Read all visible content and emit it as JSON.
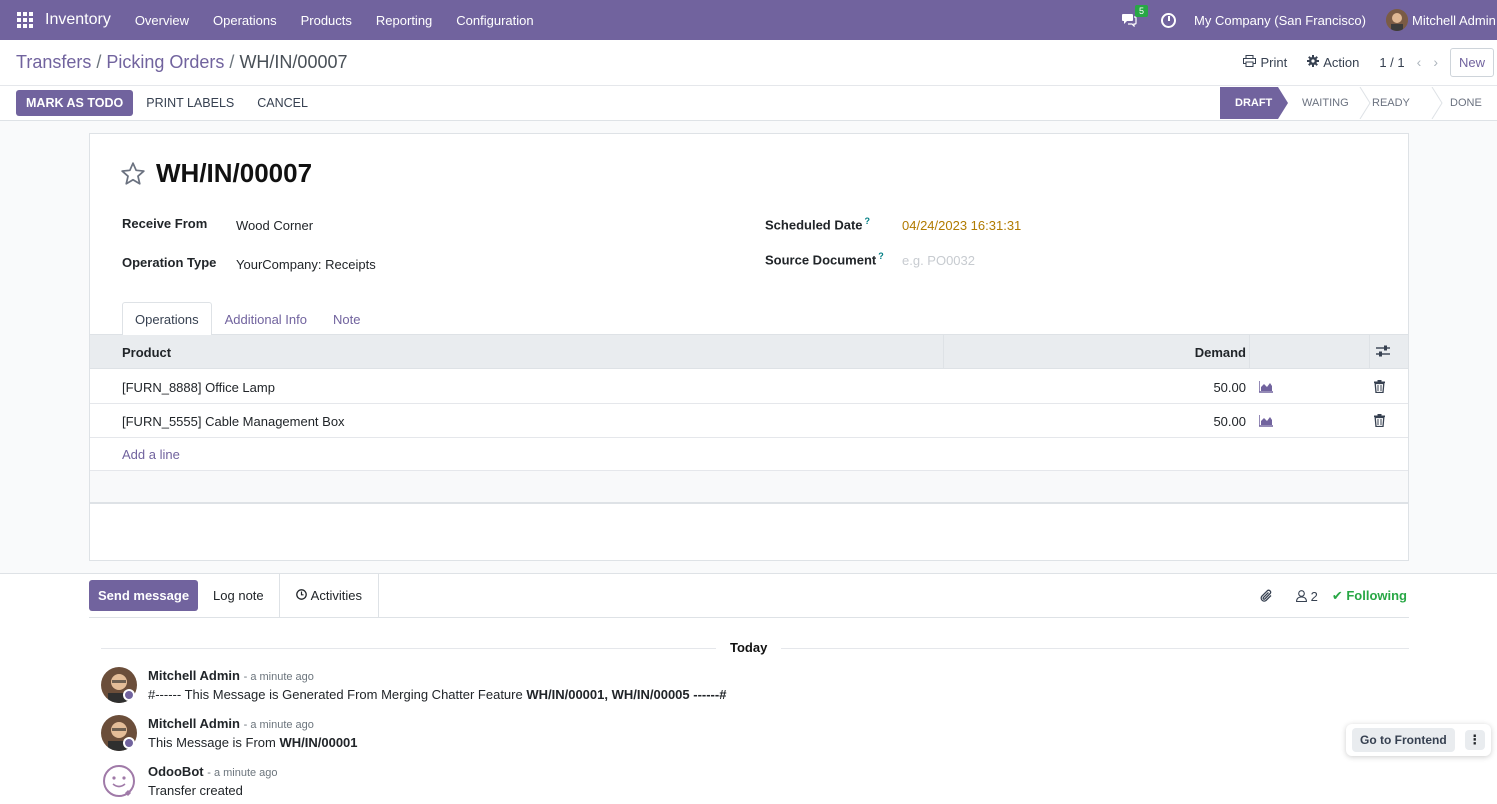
{
  "navbar": {
    "app_name": "Inventory",
    "menu": [
      "Overview",
      "Operations",
      "Products",
      "Reporting",
      "Configuration"
    ],
    "chat_count": "5",
    "company": "My Company (San Francisco)",
    "user": "Mitchell Admin"
  },
  "control_panel": {
    "breadcrumb": [
      "Transfers",
      "Picking Orders",
      "WH/IN/00007"
    ],
    "print_label": "Print",
    "action_label": "Action",
    "pager": "1 / 1",
    "new_label": "New",
    "buttons": [
      "MARK AS TODO",
      "PRINT LABELS",
      "CANCEL"
    ],
    "steps": [
      "DRAFT",
      "WAITING",
      "READY",
      "DONE"
    ],
    "active_step": "DRAFT"
  },
  "form": {
    "title": "WH/IN/00007",
    "receive_from_label": "Receive From",
    "receive_from": "Wood Corner",
    "operation_type_label": "Operation Type",
    "operation_type": "YourCompany: Receipts",
    "scheduled_date_label": "Scheduled Date",
    "scheduled_date": "04/24/2023 16:31:31",
    "source_document_label": "Source Document",
    "source_document_placeholder": "e.g. PO0032",
    "help_mark": "?",
    "tabs": [
      "Operations",
      "Additional Info",
      "Note"
    ],
    "columns": {
      "product": "Product",
      "demand": "Demand"
    },
    "rows": [
      {
        "product": "[FURN_8888] Office Lamp",
        "demand": "50.00"
      },
      {
        "product": "[FURN_5555] Cable Management Box",
        "demand": "50.00"
      }
    ],
    "add_line": "Add a line"
  },
  "chatter": {
    "send_message": "Send message",
    "log_note": "Log note",
    "activities": "Activities",
    "followers_count": "2",
    "following": "Following",
    "date_separator": "Today",
    "messages": [
      {
        "author": "Mitchell Admin",
        "time": "- a minute ago",
        "body_prefix": "#------ This Message is Generated From Merging Chatter Feature ",
        "body_bold": "WH/IN/00001, WH/IN/00005 ------#"
      },
      {
        "author": "Mitchell Admin",
        "time": "- a minute ago",
        "body_prefix": "This Message is From ",
        "body_bold": "WH/IN/00001"
      },
      {
        "author": "OdooBot",
        "time": "- a minute ago",
        "body_prefix": "Transfer created",
        "body_bold": ""
      }
    ]
  },
  "frontend_button": "Go to Frontend",
  "colors": {
    "primary": "#71639e",
    "date": "#b17b00",
    "following": "#28a745"
  }
}
